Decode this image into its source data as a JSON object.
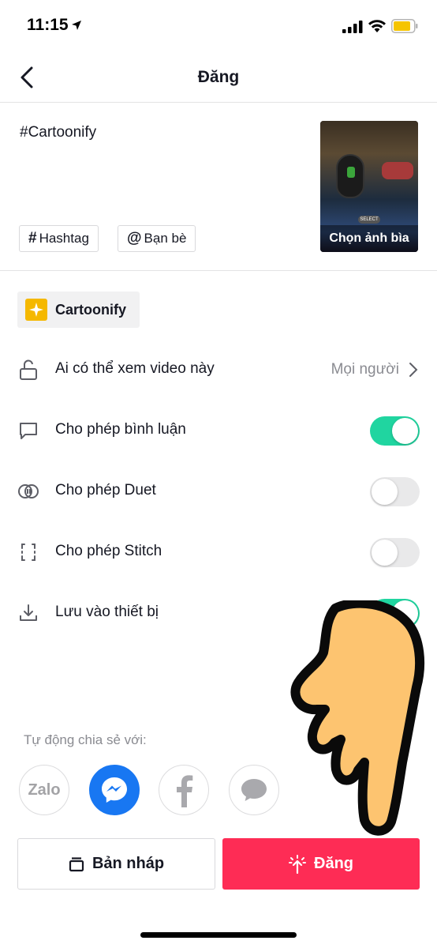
{
  "status_bar": {
    "time": "11:15"
  },
  "nav": {
    "title": "Đăng"
  },
  "caption": {
    "text": "#Cartoonify",
    "hashtag_chip": "Hashtag",
    "friends_chip": "Bạn bè",
    "cover_label": "Chọn ảnh bìa",
    "cover_select_badge": "SELECT"
  },
  "effect": {
    "label": "Cartoonify"
  },
  "settings": {
    "visibility": {
      "label": "Ai có thể xem video này",
      "value": "Mọi người"
    },
    "comments": {
      "label": "Cho phép bình luận",
      "enabled": true
    },
    "duet": {
      "label": "Cho phép Duet",
      "enabled": false
    },
    "stitch": {
      "label": "Cho phép Stitch",
      "enabled": false
    },
    "save": {
      "label": "Lưu vào thiết bị",
      "enabled": true
    }
  },
  "share": {
    "label": "Tự động chia sẻ với:",
    "zalo_text": "Zalo",
    "targets": [
      "zalo-icon",
      "messenger-icon",
      "facebook-icon",
      "message-icon"
    ]
  },
  "actions": {
    "draft_label": "Bản nháp",
    "post_label": "Đăng"
  },
  "colors": {
    "accent_green": "#20d5a0",
    "post_red": "#fe2c55",
    "messenger_blue": "#1877f2",
    "effect_yellow": "#f5b800"
  }
}
